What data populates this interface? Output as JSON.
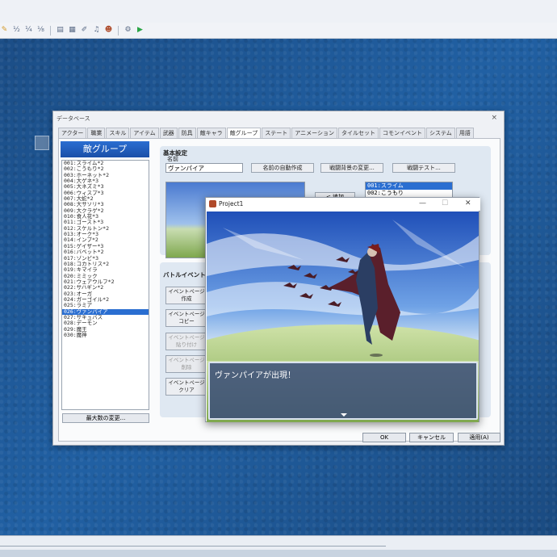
{
  "database": {
    "title": "データベース",
    "close": "×",
    "tabs": [
      "アクター",
      "職業",
      "スキル",
      "アイテム",
      "武器",
      "防具",
      "敵キャラ",
      "敵グループ",
      "ステート",
      "アニメーション",
      "タイルセット",
      "コモンイベント",
      "システム",
      "用語"
    ],
    "active_tab": 7,
    "list_header": "敵グループ",
    "troops": [
      "001:スライム*2",
      "002:こうもり*2",
      "003:ホーネット*2",
      "004:大ゲネ*3",
      "005:大ネズミ*3",
      "006:ウィスプ*3",
      "007:大蛇*2",
      "008:大サソリ*3",
      "009:大クラゲ*2",
      "010:食人花*3",
      "011:ゴースト*3",
      "012:スケルトン*2",
      "013:オーク*3",
      "014:インプ*2",
      "015:ゲイザー*3",
      "016:バベット*2",
      "017:ゾンビ*3",
      "018:コカトリス*2",
      "019:キマイラ",
      "020:ミミック",
      "021:ウェアウルフ*2",
      "022:サハギン*2",
      "023:オーガ",
      "024:ガーゴイル*2",
      "025:ラミア",
      "026:ヴァンパイア",
      "027:サキュバス",
      "028:デーモン",
      "029:魔王",
      "030:魔神"
    ],
    "selected_index": 25,
    "max_button": "最大数の変更...",
    "basic_settings": "基本設定",
    "name_label": "名前",
    "name_value": "ヴァンパイア",
    "auto_name_button": "名前の自動作成",
    "change_bg_button": "戦闘背景の変更...",
    "battle_test_button": "戦闘テスト...",
    "add_button": "< 追加",
    "troop_members": [
      "001:スライム",
      "002:こうもり"
    ],
    "battle_event": "バトルイベント",
    "event_buttons": [
      {
        "label1": "イベントページ",
        "label2": "作成",
        "disabled": false
      },
      {
        "label1": "イベントページ",
        "label2": "コピー",
        "disabled": false
      },
      {
        "label1": "イベントページ",
        "label2": "貼り付け",
        "disabled": true
      },
      {
        "label1": "イベントページ",
        "label2": "削除",
        "disabled": true
      },
      {
        "label1": "イベントページ",
        "label2": "クリア",
        "disabled": false
      }
    ],
    "ok": "OK",
    "cancel": "キャンセル",
    "apply": "適用(A)"
  },
  "game_window": {
    "title": "Project1",
    "minimize": "—",
    "maximize": "☐",
    "close": "✕",
    "message": "ヴァンパイアが出現！"
  },
  "colors": {
    "selection": "#2a6ed1",
    "desktop": "#1d4f86"
  }
}
